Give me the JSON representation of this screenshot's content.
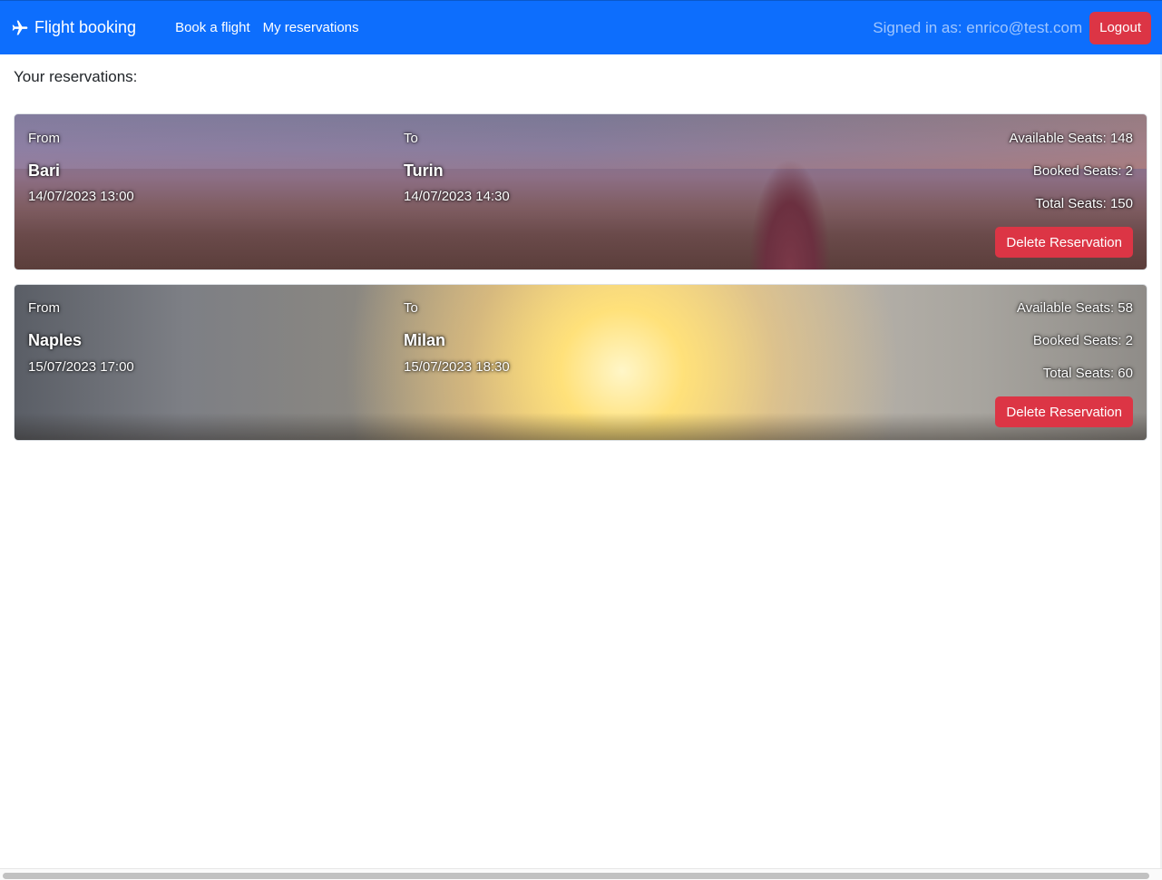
{
  "navbar": {
    "brand": "Flight booking",
    "links": [
      "Book a flight",
      "My reservations"
    ],
    "signed_in": "Signed in as: enrico@test.com",
    "logout_label": "Logout",
    "color": "#0d6efd"
  },
  "heading": "Your reservations:",
  "reservations": [
    {
      "from_label": "From",
      "from_city": "Bari",
      "from_datetime": "14/07/2023 13:00",
      "to_label": "To",
      "to_city": "Turin",
      "to_datetime": "14/07/2023 14:30",
      "available_seats": "Available Seats: 148",
      "booked_seats": "Booked Seats: 2",
      "total_seats": "Total Seats: 150",
      "delete_label": "Delete Reservation"
    },
    {
      "from_label": "From",
      "from_city": "Naples",
      "from_datetime": "15/07/2023 17:00",
      "to_label": "To",
      "to_city": "Milan",
      "to_datetime": "15/07/2023 18:30",
      "available_seats": "Available Seats: 58",
      "booked_seats": "Booked Seats: 2",
      "total_seats": "Total Seats: 60",
      "delete_label": "Delete Reservation"
    }
  ],
  "icons": {
    "brand": "airplane-icon"
  },
  "colors": {
    "danger": "#dc3545"
  }
}
